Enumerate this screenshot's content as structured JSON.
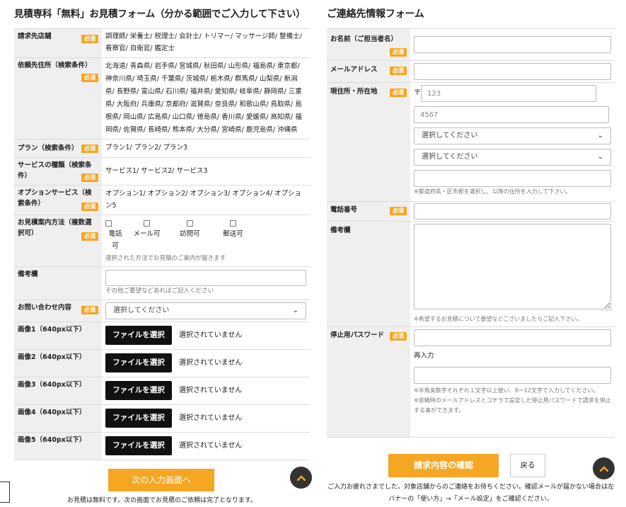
{
  "left": {
    "title": "見積専科「無料」お見積フォーム（分かる範囲でご入力して下さい）",
    "required_badge": "必須",
    "rows": {
      "shop_type": {
        "label": "請求先店舗",
        "value": "調理師/ 栄養士/ 税理士/ 会計士/ トリマー/ マッサージ師/ 整備士/ 看察官/ 自衛官/ 鑑定士"
      },
      "location": {
        "label": "依頼先住所（検索条件）",
        "value": "北海道/ 青森県/ 岩手県/ 宮城県/ 秋田県/ 山形県/ 福島県/ 東京都/ 神奈川県/ 埼玉県/ 千葉県/ 茨城県/ 栃木県/ 群馬県/ 山梨県/ 新潟県/ 長野県/ 富山県/ 石川県/ 福井県/ 愛知県/ 岐阜県/ 静岡県/ 三重県/ 大阪府/ 兵庫県/ 京都府/ 滋賀県/ 奈良県/ 和歌山県/ 鳥取県/ 島根県/ 岡山県/ 広島県/ 山口県/ 徳島県/ 香川県/ 愛媛県/ 高知県/ 福岡県/ 佐賀県/ 長崎県/ 熊本県/ 大分県/ 宮崎県/ 鹿児島県/ 沖縄県"
      },
      "plan": {
        "label": "プラン（検索条件）",
        "value": "プラン1/ プラン2/ プラン3"
      },
      "service": {
        "label": "サービスの種類（検索条件）",
        "value": "サービス1/ サービス2/ サービス3"
      },
      "option": {
        "label": "オプションサービス（検索条件）",
        "value": "オプション1/ オプション2/ オプション3/ オプション4/ オプション5"
      },
      "method": {
        "label": "お見積案内方法（複数選択可）",
        "options": [
          "電話可",
          "メール可",
          "訪問可",
          "郵送可"
        ],
        "note": "選択された方法でお見積のご案内が届きます"
      },
      "remarks": {
        "label": "備考欄",
        "value": "",
        "note": "その他ご要望などあればご記入ください"
      },
      "inquiry": {
        "label": "お問い合わせ内容",
        "selected": "選択してください"
      },
      "images": [
        {
          "label": "画像1（640px以下）"
        },
        {
          "label": "画像2（640px以下）"
        },
        {
          "label": "画像3（640px以下）"
        },
        {
          "label": "画像4（640px以下）"
        },
        {
          "label": "画像5（640px以下）"
        }
      ],
      "file_button": "ファイルを選択",
      "file_none": "選択されていません"
    },
    "next_button": "次の入力画面へ",
    "footer": "お見積は無料です。次の画面でお見積のご依頼は完了となります。"
  },
  "right": {
    "title": "ご連絡先情報フォーム",
    "required_badge": "必須",
    "rows": {
      "name": {
        "label": "お名前（ご担当者名）",
        "value": ""
      },
      "email": {
        "label": "メールアドレス",
        "value": ""
      },
      "address": {
        "label": "現住所・所在地",
        "postal_mark": "〒",
        "zip1_placeholder": "123",
        "zip2_placeholder": "4567",
        "pref_selected": "選択してください",
        "city_selected": "選択してください",
        "street": "",
        "note": "※都道府県・区市郡を選択し、以降の住所を入力して下さい。"
      },
      "phone": {
        "label": "電話番号",
        "value": ""
      },
      "remarks": {
        "label": "備考欄",
        "value": "",
        "note": "※希望するお見積について要望などございましたらご記入下さい。"
      },
      "password": {
        "label": "停止用パスワード",
        "value": "",
        "reenter_label": "再入力",
        "reenter_value": "",
        "note1": "※半角英数字それぞれ１文字以上使い、8～12文字で入力してください。",
        "note2": "※依頼時のメールアドレスとコチラで設定した停止用パスワードで請求を停止する事ができます。"
      }
    },
    "confirm_button": "請求内容の確認",
    "back_button": "戻る",
    "footer": "ご入力お疲れさまでした。対象店舗からのご連絡をお待ちください。確認メールが届かない場合は左バナーの「使い方」→「メール設定」をご確認ください。"
  },
  "icons": {
    "scroll_top": "chevron-up-icon",
    "accent": "#f5a623"
  }
}
